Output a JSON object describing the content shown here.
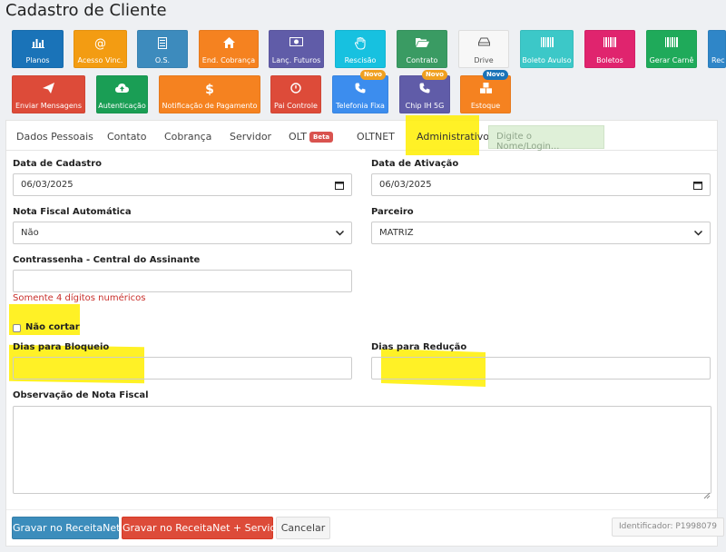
{
  "page": {
    "title": "Cadastro de Cliente"
  },
  "tiles_row1": [
    {
      "label": "Planos",
      "color": "#1a73b8",
      "icon": "bar-chart-icon"
    },
    {
      "label": "Acesso Vinc.",
      "color": "#f39c12",
      "icon": "at-sign-icon"
    },
    {
      "label": "O.S.",
      "color": "#3d8bbd",
      "icon": "document-icon"
    },
    {
      "label": "End. Cobrança",
      "color": "#f58220",
      "icon": "home-icon"
    },
    {
      "label": "Lanç. Futuros",
      "color": "#605ca8",
      "icon": "money-icon"
    },
    {
      "label": "Rescisão",
      "color": "#17c1e0",
      "icon": "hand-icon"
    },
    {
      "label": "Contrato",
      "color": "#3a9b63",
      "icon": "folder-open-icon"
    },
    {
      "label": "Drive",
      "color": "#f7f7f7",
      "icon": "hard-drive-icon"
    },
    {
      "label": "Boleto Avulso",
      "color": "#3cc8c8",
      "icon": "barcode-icon"
    },
    {
      "label": "Boletos",
      "color": "#e0246e",
      "icon": "barcode-icon"
    },
    {
      "label": "Gerar Carnê",
      "color": "#1faa5a",
      "icon": "barcode-icon"
    },
    {
      "label": "Rec",
      "color": "#2f86c8",
      "icon": "receipt-icon"
    }
  ],
  "tiles_row2": [
    {
      "label": "Enviar Mensagens",
      "color": "#dd4b39",
      "icon": "paper-plane-icon",
      "badge": ""
    },
    {
      "label": "Autenticação",
      "color": "#1a9e55",
      "icon": "cloud-upload-icon",
      "badge": ""
    },
    {
      "label": "Notificação de Pagamento",
      "color": "#f58220",
      "icon": "dollar-icon",
      "badge": ""
    },
    {
      "label": "Pai Controle",
      "color": "#dd4b39",
      "icon": "ban-icon",
      "badge": ""
    },
    {
      "label": "Telefonia Fixa",
      "color": "#3c8dee",
      "icon": "phone-icon",
      "badge": "Novo"
    },
    {
      "label": "Chip IH 5G",
      "color": "#605ca8",
      "icon": "phone-icon",
      "badge": "Novo"
    },
    {
      "label": "Estoque",
      "color": "#f58220",
      "icon": "cubes-icon",
      "badge": "Novo"
    }
  ],
  "colors": {
    "badge_orange": "#f0a020",
    "badge_blue": "#1a73b8"
  },
  "tabs": [
    "Dados Pessoais",
    "Contato",
    "Cobrança",
    "Servidor",
    "OLT",
    "OLTNET",
    "Administrativo"
  ],
  "tab_olt_badge": "Beta",
  "tab_search_placeholder": "Digite o Nome/Login...",
  "form": {
    "data_cadastro_label": "Data de Cadastro",
    "data_cadastro_value": "06/03/2025",
    "data_ativacao_label": "Data de Ativação",
    "data_ativacao_value": "06/03/2025",
    "nota_fiscal_label": "Nota Fiscal Automática",
    "nota_fiscal_value": "Não",
    "parceiro_label": "Parceiro",
    "parceiro_value": "MATRIZ",
    "contrassenha_label": "Contrassenha - Central do Assinante",
    "contrassenha_value": "",
    "contrassenha_hint": "Somente 4 dígitos numéricos",
    "nao_cortar_label": "Não cortar",
    "dias_bloqueio_label": "Dias para Bloqueio",
    "dias_bloqueio_value": "",
    "dias_reducao_label": "Dias para Redução",
    "dias_reducao_value": "",
    "observacao_label": "Observação de Nota Fiscal",
    "observacao_value": ""
  },
  "footer": {
    "save_label": "Gravar no ReceitaNet",
    "save_server_label": "Gravar no ReceitaNet + Servidor",
    "cancel_label": "Cancelar",
    "identifier": "Identificador: P1998079"
  }
}
